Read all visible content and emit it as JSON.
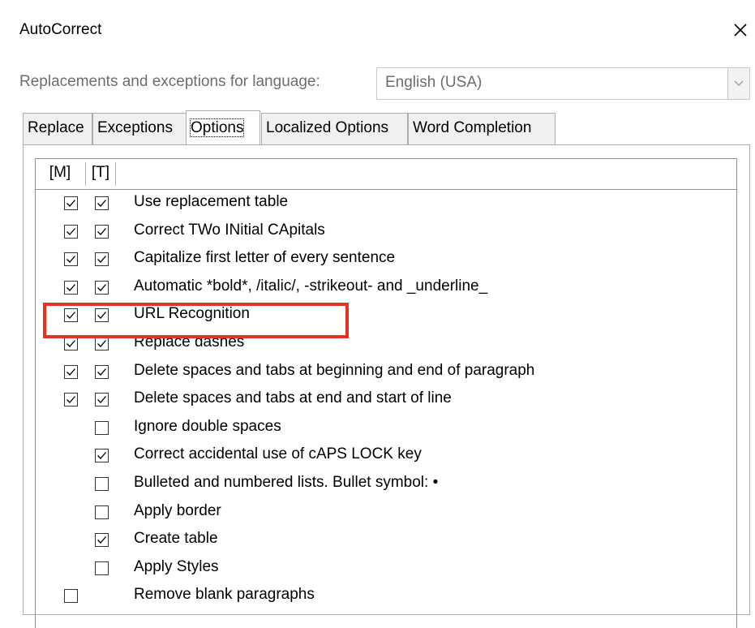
{
  "dialog": {
    "title": "AutoCorrect",
    "close_icon": "close-icon"
  },
  "language": {
    "label": "Replacements and exceptions for language:",
    "value": "English (USA)"
  },
  "tabs": [
    {
      "label": "Replace"
    },
    {
      "label": "Exceptions"
    },
    {
      "label": "Options",
      "active": true
    },
    {
      "label": "Localized Options"
    },
    {
      "label": "Word Completion"
    }
  ],
  "columns": {
    "m": "[M]",
    "t": "[T]"
  },
  "options": [
    {
      "label": "Use replacement table",
      "m": true,
      "t": true
    },
    {
      "label": "Correct TWo INitial CApitals",
      "m": true,
      "t": true
    },
    {
      "label": "Capitalize first letter of every sentence",
      "m": true,
      "t": true
    },
    {
      "label": "Automatic *bold*, /italic/, -strikeout- and _underline_",
      "m": true,
      "t": true
    },
    {
      "label": "URL Recognition",
      "m": true,
      "t": true,
      "highlighted": true
    },
    {
      "label": "Replace dashes",
      "m": true,
      "t": true
    },
    {
      "label": "Delete spaces and tabs at beginning and end of paragraph",
      "m": true,
      "t": true
    },
    {
      "label": "Delete spaces and tabs at end and start of line",
      "m": true,
      "t": true
    },
    {
      "label": "Ignore double spaces",
      "m": null,
      "t": false
    },
    {
      "label": "Correct accidental use of cAPS LOCK key",
      "m": null,
      "t": true
    },
    {
      "label": "Bulleted and numbered lists. Bullet symbol: •",
      "m": null,
      "t": false
    },
    {
      "label": "Apply border",
      "m": null,
      "t": false
    },
    {
      "label": "Create table",
      "m": null,
      "t": true
    },
    {
      "label": "Apply Styles",
      "m": null,
      "t": false
    },
    {
      "label": "Remove blank paragraphs",
      "m": false,
      "t": null
    }
  ],
  "colors": {
    "highlight": "#e8321f"
  }
}
